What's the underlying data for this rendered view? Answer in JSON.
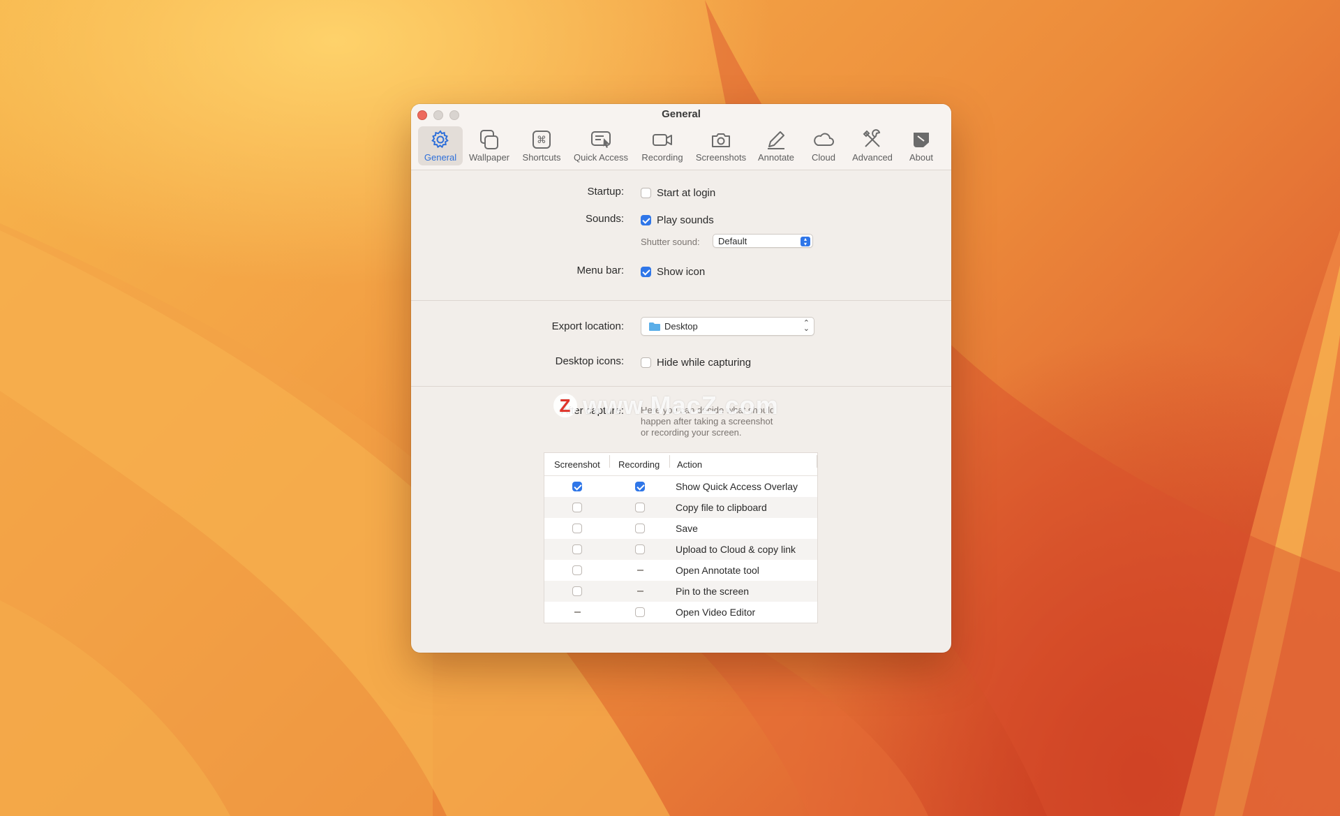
{
  "window": {
    "title": "General"
  },
  "toolbar": {
    "items": [
      {
        "label": "General",
        "icon": "gear-icon",
        "active": true
      },
      {
        "label": "Wallpaper",
        "icon": "wallpaper-icon",
        "active": false
      },
      {
        "label": "Shortcuts",
        "icon": "command-key-icon",
        "active": false
      },
      {
        "label": "Quick Access",
        "icon": "quick-access-icon",
        "active": false
      },
      {
        "label": "Recording",
        "icon": "video-camera-icon",
        "active": false
      },
      {
        "label": "Screenshots",
        "icon": "camera-icon",
        "active": false
      },
      {
        "label": "Annotate",
        "icon": "pencil-icon",
        "active": false
      },
      {
        "label": "Cloud",
        "icon": "cloud-icon",
        "active": false
      },
      {
        "label": "Advanced",
        "icon": "tools-icon",
        "active": false
      },
      {
        "label": "About",
        "icon": "about-icon",
        "active": false
      }
    ]
  },
  "general": {
    "startup_label": "Startup:",
    "start_at_login": {
      "label": "Start at login",
      "checked": false
    },
    "sounds_label": "Sounds:",
    "play_sounds": {
      "label": "Play sounds",
      "checked": true
    },
    "shutter_sound_label": "Shutter sound:",
    "shutter_sound_value": "Default",
    "menubar_label": "Menu bar:",
    "show_icon": {
      "label": "Show icon",
      "checked": true
    }
  },
  "export": {
    "export_location_label": "Export location:",
    "export_location_value": "Desktop",
    "desktop_icons_label": "Desktop icons:",
    "hide_while_capturing": {
      "label": "Hide while capturing",
      "checked": false
    }
  },
  "after_capture": {
    "label": "After capture:",
    "description_lines": [
      "Here you can decide what should",
      "happen after taking a screenshot",
      "or recording your screen."
    ],
    "columns": [
      "Screenshot",
      "Recording",
      "Action"
    ],
    "rows": [
      {
        "screenshot": "checked",
        "recording": "checked",
        "action": "Show Quick Access Overlay"
      },
      {
        "screenshot": "unchecked",
        "recording": "unchecked",
        "action": "Copy file to clipboard"
      },
      {
        "screenshot": "unchecked",
        "recording": "unchecked",
        "action": "Save"
      },
      {
        "screenshot": "unchecked",
        "recording": "unchecked",
        "action": "Upload to Cloud & copy link"
      },
      {
        "screenshot": "unchecked",
        "recording": "na",
        "action": "Open Annotate tool"
      },
      {
        "screenshot": "unchecked",
        "recording": "na",
        "action": "Pin to the screen"
      },
      {
        "screenshot": "na",
        "recording": "unchecked",
        "action": "Open Video Editor"
      }
    ]
  },
  "watermark": {
    "logo": "Z",
    "text": "www.MacZ.com"
  },
  "colors": {
    "accent": "#2f76e8",
    "close_button": "#ed6a5e"
  }
}
